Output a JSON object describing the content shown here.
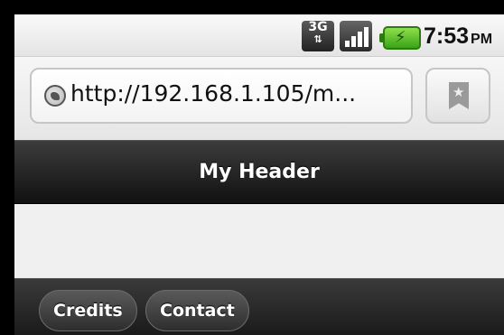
{
  "status_bar": {
    "network_label": "3G",
    "network_icon": "3g-data-icon",
    "signal_icon": "signal-strength-icon",
    "battery_icon": "battery-charging-icon",
    "time": "7:53",
    "ampm": "PM"
  },
  "address_bar": {
    "url": "http://192.168.1.105/m...",
    "site_icon": "globe-icon",
    "bookmark_icon": "bookmark-star-icon"
  },
  "header": {
    "title": "My Header"
  },
  "footer": {
    "buttons": [
      {
        "label": "Credits"
      },
      {
        "label": "Contact"
      }
    ]
  },
  "colors": {
    "header_bg": "#1f1f1f",
    "battery": "#5cc22a",
    "content_bg": "#f0f0f0"
  }
}
